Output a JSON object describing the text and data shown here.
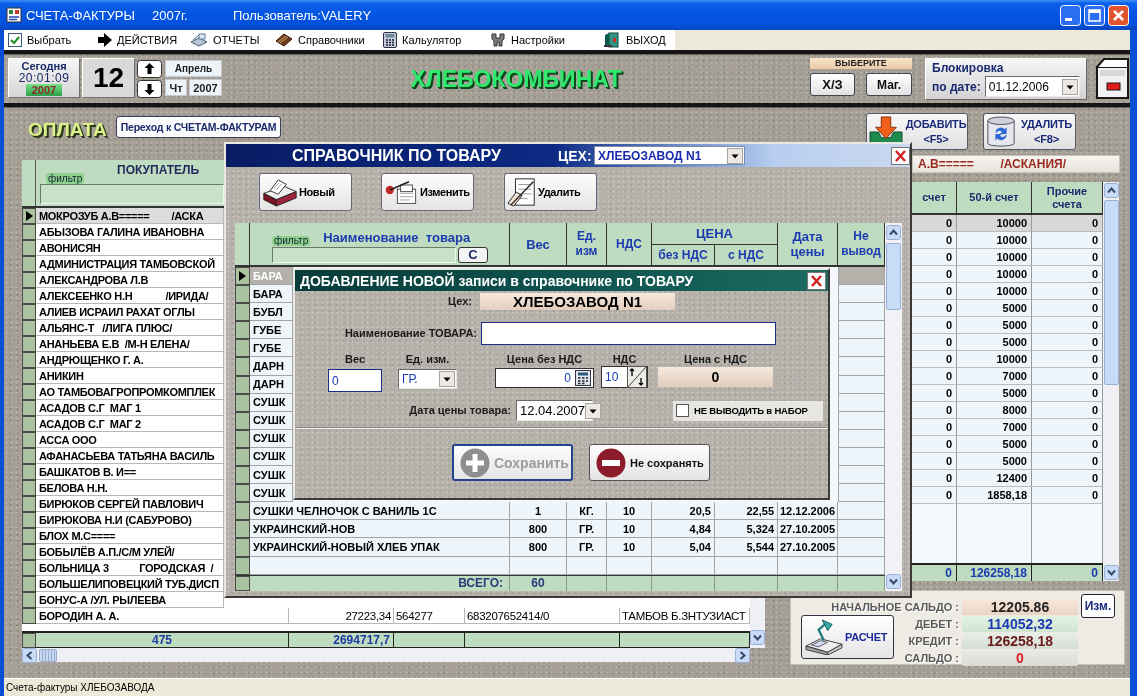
{
  "window": {
    "title": "СЧЕТА-ФАКТУРЫ",
    "year": "2007г.",
    "user": "Пользователь:VALERY"
  },
  "menu": [
    {
      "label": "Выбрать"
    },
    {
      "label": "ДЕЙСТВИЯ"
    },
    {
      "label": "ОТЧЕТЫ"
    },
    {
      "label": "Справочники"
    },
    {
      "label": "Кальулятор"
    },
    {
      "label": "Настройки"
    },
    {
      "label": "ВЫХОД"
    }
  ],
  "header": {
    "clock": {
      "label": "Сегодня",
      "time": "20:01:09",
      "year": "2007"
    },
    "day": "12",
    "month": "Апрель",
    "weekday": "Чт",
    "year": "2007",
    "banner": "ХЛЕБОКОМБИНАТ",
    "choose": {
      "label": "ВЫБЕРИТЕ",
      "buttons": [
        "Х/З",
        "Маг."
      ]
    },
    "lock": {
      "label": "Блокировка",
      "sublabel": "по дате:",
      "date": "01.12.2006"
    }
  },
  "payment_bar": {
    "title": "ОПЛАТА",
    "link_button": "Переход к СЧЕТАМ-ФАКТУРАМ",
    "buttons": [
      {
        "label": "ДОБАВИТЬ",
        "key": "<F5>"
      },
      {
        "label": "УДАЛИТЬ",
        "key": "<F8>"
      }
    ]
  },
  "customers": {
    "column": "ПОКУПАТЕЛЬ",
    "filter_label": "фильтр",
    "rows": [
      {
        "name": "МОКРОЗУБ А.В=====        /АСКА",
        "selected": true
      },
      {
        "name": "АБЫЗОВА ГАЛИНА ИВАНОВНА",
        "selected": false
      },
      {
        "name": "АВОНИСЯН",
        "selected": false
      },
      {
        "name": "АДМИНИСТРАЦИЯ ТАМБОВСКОЙ",
        "selected": false
      },
      {
        "name": "АЛЕКСАНДРОВА Л.В",
        "selected": false
      },
      {
        "name": "АЛЕКСЕЕНКО Н.Н            /ИРИДА/",
        "selected": false
      },
      {
        "name": "АЛИЕВ ИСРАИЛ РАХАТ ОГЛЫ",
        "selected": false
      },
      {
        "name": "АЛЬЯНС-Т   /ЛИГА ПЛЮС/",
        "selected": false
      },
      {
        "name": "АНАНЬЕВА Е.В  /М-Н ЕЛЕНА/",
        "selected": false
      },
      {
        "name": "АНДРЮЩЕНКО Г. А.",
        "selected": false
      },
      {
        "name": "АНИКИН",
        "selected": false
      },
      {
        "name": "АО ТАМБОВАГРОПРОМКОМПЛЕК",
        "selected": false
      },
      {
        "name": "АСАДОВ С.Г  МАГ 1",
        "selected": false
      },
      {
        "name": "АСАДОВ С.Г  МАГ 2",
        "selected": false
      },
      {
        "name": "АССА ООО",
        "selected": false
      },
      {
        "name": "АФАНАСЬЕВА ТАТЬЯНА ВАСИЛЬ",
        "selected": false
      },
      {
        "name": "БАШКАТОВ В. И==",
        "selected": false
      },
      {
        "name": "БЕЛОВА Н.Н.",
        "selected": false
      },
      {
        "name": "БИРЮКОВ СЕРГЕЙ ПАВЛОВИЧ",
        "selected": false
      },
      {
        "name": "БИРЮКОВА Н.И (САБУРОВО)",
        "selected": false
      },
      {
        "name": "БЛОХ М.С====",
        "selected": false
      },
      {
        "name": "БОБЫЛЁВ А.П./С/М УЛЕЙ/",
        "selected": false
      },
      {
        "name": "БОЛЬНИЦА 3           ГОРОДСКАЯ  /",
        "selected": false
      },
      {
        "name": "БОЛЬШЕЛИПОВЕЦКИЙ ТУБ.ДИСП",
        "selected": false
      },
      {
        "name": "БОНУС-А /УЛ. РЫЛЕЕВА",
        "selected": false
      },
      {
        "name": "БОРОДИН А. А.",
        "selected": false,
        "cells": [
          "27223,34",
          "564277",
          "683207652414/0",
          "ТАМБОВ Б.ЗНТУЗИАСТ"
        ]
      }
    ],
    "totals": {
      "count": "475",
      "sum": "2694717,7"
    }
  },
  "accounts": {
    "customer": "А.В=====        /АСКАНИЯ/",
    "columns": [
      "счет",
      "50-й счет",
      "Прочие счета"
    ],
    "rows": [
      {
        "cells": [
          "0",
          "10000",
          "0"
        ],
        "selected": true
      },
      {
        "cells": [
          "0",
          "10000",
          "0"
        ],
        "selected": false
      },
      {
        "cells": [
          "0",
          "10000",
          "0"
        ],
        "selected": false
      },
      {
        "cells": [
          "0",
          "10000",
          "0"
        ],
        "selected": false
      },
      {
        "cells": [
          "0",
          "10000",
          "0"
        ],
        "selected": false
      },
      {
        "cells": [
          "0",
          "5000",
          "0"
        ],
        "selected": false
      },
      {
        "cells": [
          "0",
          "5000",
          "0"
        ],
        "selected": false
      },
      {
        "cells": [
          "0",
          "5000",
          "0"
        ],
        "selected": false
      },
      {
        "cells": [
          "0",
          "10000",
          "0"
        ],
        "selected": false
      },
      {
        "cells": [
          "0",
          "7000",
          "0"
        ],
        "selected": false
      },
      {
        "cells": [
          "0",
          "5000",
          "0"
        ],
        "selected": false
      },
      {
        "cells": [
          "0",
          "8000",
          "0"
        ],
        "selected": false
      },
      {
        "cells": [
          "0",
          "7000",
          "0"
        ],
        "selected": false
      },
      {
        "cells": [
          "0",
          "5000",
          "0"
        ],
        "selected": false
      },
      {
        "cells": [
          "0",
          "5000",
          "0"
        ],
        "selected": false
      },
      {
        "cells": [
          "0",
          "12400",
          "0"
        ],
        "selected": false
      },
      {
        "cells": [
          "0",
          "1858,18",
          "0"
        ],
        "selected": false
      }
    ],
    "totals": [
      "0",
      "126258,18",
      "0"
    ]
  },
  "balance": {
    "calc_button": "РАСЧЕТ",
    "edit_button": "Изм.",
    "lines": [
      {
        "label": "НАЧАЛЬНОЕ САЛЬДО :",
        "value": "12205.86",
        "kind": "opening"
      },
      {
        "label": "ДЕБЕТ :",
        "value": "114052,32",
        "kind": "debit"
      },
      {
        "label": "КРЕДИТ :",
        "value": "126258,18",
        "kind": "credit"
      },
      {
        "label": "САЛЬДО :",
        "value": "0",
        "kind": "result"
      }
    ]
  },
  "product_dialog": {
    "title": "СПРАВОЧНИК ПО ТОВАРУ",
    "shop_label": "ЦЕХ:",
    "shop": "ХЛЕБОЗАВОД N1",
    "buttons": [
      "Новый",
      "Изменить",
      "Удалить"
    ],
    "table": {
      "filter_label": "фильтр",
      "clear_button": "С",
      "columns": [
        "Наименование  товара",
        "Вес",
        "Ед. изм",
        "НДС",
        "без НДС",
        "с НДС",
        "Дата цены",
        "Не вывод"
      ],
      "price_group": "ЦЕНА",
      "rows": [
        {
          "name": "БАРА",
          "selected": true
        },
        {
          "name": "БАРА",
          "selected": false
        },
        {
          "name": "БУБЛ",
          "selected": false
        },
        {
          "name": "ГУБЕ",
          "selected": false
        },
        {
          "name": "ГУБЕ",
          "selected": false
        },
        {
          "name": "ДАРН",
          "selected": false
        },
        {
          "name": "ДАРН",
          "selected": false
        },
        {
          "name": "СУШК",
          "selected": false
        },
        {
          "name": "СУШК",
          "selected": false
        },
        {
          "name": "СУШК",
          "selected": false
        },
        {
          "name": "СУШК",
          "selected": false
        },
        {
          "name": "СУШК",
          "selected": false
        },
        {
          "name": "СУШК",
          "selected": false
        },
        {
          "name": "СУШКИ ЧЕЛНОЧОК С ВАНИЛЬ 1С",
          "selected": false,
          "cells": [
            "1",
            "КГ.",
            "10",
            "20,5",
            "22,55",
            "12.12.2006"
          ]
        },
        {
          "name": "УКРАИНСКИЙ-НОВ",
          "selected": false,
          "cells": [
            "800",
            "ГР.",
            "10",
            "4,84",
            "5,324",
            "27.10.2005"
          ]
        },
        {
          "name": "УКРАИНСКИЙ-НОВЫЙ ХЛЕБ УПАК",
          "selected": false,
          "cells": [
            "800",
            "ГР.",
            "10",
            "5,04",
            "5,544",
            "27.10.2005"
          ]
        }
      ],
      "total_label": "ВСЕГО:",
      "total": "60"
    }
  },
  "add_dialog": {
    "title": "ДОБАВЛЕНИЕ НОВОЙ записи в справочнике по ТОВАРУ",
    "shop": {
      "label": "Цех:",
      "value": "ХЛЕБОЗАВОД N1"
    },
    "product_name": {
      "label": "Наименование ТОВАРА:"
    },
    "weight": {
      "label": "Вес",
      "value": "0"
    },
    "unit": {
      "label": "Ед. изм.",
      "value": "ГР."
    },
    "price": {
      "label": "Цена без НДС",
      "value": "0"
    },
    "vat": {
      "label": "НДС",
      "value": "10"
    },
    "price_with_vat": {
      "label": "Цена с НДС",
      "value": "0"
    },
    "price_date": {
      "label": "Дата цены товара:",
      "value": "12.04.2007"
    },
    "exclude": {
      "label": "НЕ ВЫВОДИТЬ в НАБОР",
      "checked": false
    },
    "buttons": [
      {
        "label": "Сохранить",
        "disabled": true
      },
      {
        "label": "Не сохранять",
        "disabled": false
      }
    ]
  },
  "status_bar": "Счета-фактуры ХЛЕБОЗАВОДА"
}
